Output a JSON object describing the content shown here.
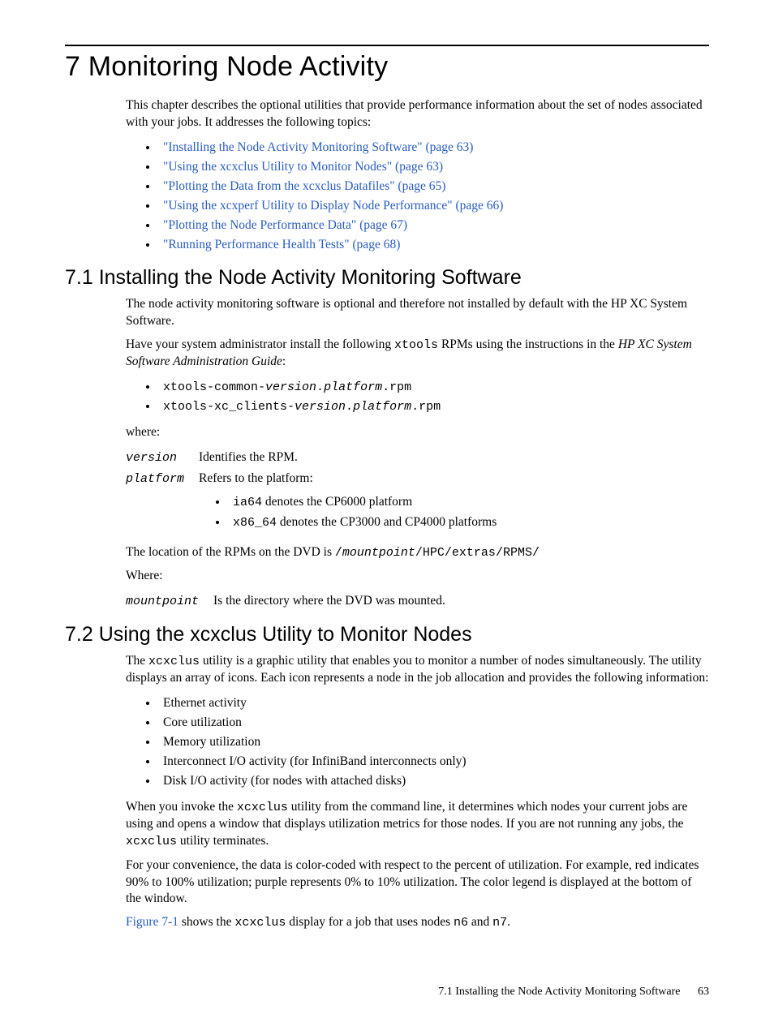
{
  "chapter": {
    "number": "7",
    "title": "Monitoring Node Activity"
  },
  "intro": {
    "para": "This chapter describes the optional utilities that provide performance information about the set of nodes associated with your jobs. It addresses the following topics:",
    "topics": [
      "\"Installing the Node Activity Monitoring Software\" (page 63)",
      "\"Using the xcxclus Utility to Monitor Nodes\" (page 63)",
      "\"Plotting the Data from the xcxclus Datafiles\" (page 65)",
      "\"Using the xcxperf Utility to Display Node Performance\" (page 66)",
      "\"Plotting the Node Performance Data\" (page 67)",
      "\"Running Performance Health Tests\" (page 68)"
    ]
  },
  "sec71": {
    "heading": "7.1 Installing the Node Activity Monitoring Software",
    "p1": "The node activity monitoring software is optional and therefore not installed by default with the HP XC System Software.",
    "p2_a": "Have your system administrator install the following ",
    "p2_code": "xtools",
    "p2_b": " RPMs using the instructions in the ",
    "p2_italic": "HP XC System Software Administration Guide",
    "p2_c": ":",
    "rpm1_a": "xtools-common-",
    "rpm1_v": "version",
    "rpm1_dot1": ".",
    "rpm1_p": "platform",
    "rpm1_end": ".rpm",
    "rpm2_a": "xtools-xc_clients-",
    "rpm2_v": "version",
    "rpm2_dot1": ".",
    "rpm2_p": "platform",
    "rpm2_end": ".rpm",
    "where1": "where:",
    "def_version_term": "version",
    "def_version_desc": "Identifies the RPM.",
    "def_platform_term": "platform",
    "def_platform_desc": "Refers to the platform:",
    "plat1_code": "ia64",
    "plat1_rest": " denotes the CP6000 platform",
    "plat2_code": "x86_64",
    "plat2_rest": " denotes the CP3000 and CP4000 platforms",
    "loc_a": "The location of the RPMs on the DVD is ",
    "loc_code_a": "/",
    "loc_code_mp": "mountpoint",
    "loc_code_b": "/HPC/extras/RPMS/",
    "where2": "Where:",
    "def_mp_term": "mountpoint",
    "def_mp_desc": "Is the directory where the DVD was mounted."
  },
  "sec72": {
    "heading": "7.2 Using the xcxclus Utility to Monitor Nodes",
    "p1_a": "The ",
    "p1_code": "xcxclus",
    "p1_b": " utility is a graphic utility that enables you to monitor a number of nodes simultaneously. The utility displays an array of icons. Each icon represents a node in the job allocation and provides the following information:",
    "info_items": [
      "Ethernet activity",
      "Core utilization",
      "Memory utilization",
      "Interconnect I/O activity (for InfiniBand interconnects only)",
      "Disk I/O activity (for nodes with attached disks)"
    ],
    "p2_a": "When you invoke the ",
    "p2_code1": "xcxclus",
    "p2_b": " utility from the command line, it determines which nodes your current jobs are using and opens a window that displays utilization metrics for those nodes. If you are not running any jobs, the ",
    "p2_code2": "xcxclus",
    "p2_c": " utility terminates.",
    "p3": "For your convenience, the data is color-coded with respect to the percent of utilization. For example, red indicates 90% to 100% utilization; purple represents 0% to 10% utilization. The color legend is displayed at the bottom of the window.",
    "p4_link": "Figure 7-1",
    "p4_a": " shows the ",
    "p4_code1": "xcxclus",
    "p4_b": " display for a job that uses nodes ",
    "p4_code2": "n6",
    "p4_c": " and ",
    "p4_code3": "n7",
    "p4_d": "."
  },
  "footer": {
    "text": "7.1 Installing the Node Activity Monitoring Software",
    "page": "63"
  }
}
